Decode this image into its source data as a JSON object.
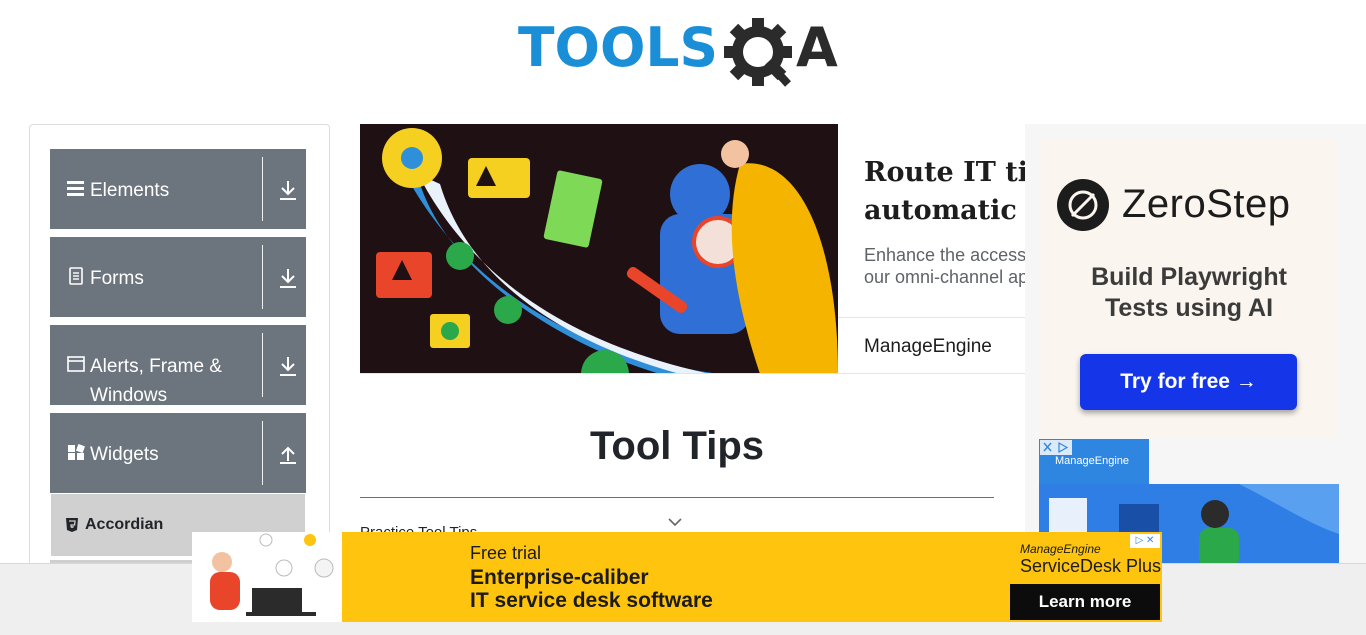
{
  "header": {
    "logo_text": "TOOLSQA"
  },
  "sidebar": {
    "groups": [
      {
        "label": "Elements",
        "icon": "hamburger-icon",
        "arrow": "download-arrow-icon"
      },
      {
        "label": "Forms",
        "icon": "document-icon",
        "arrow": "download-arrow-icon"
      },
      {
        "label": "Alerts, Frame & Windows",
        "icon": "window-icon",
        "arrow": "download-arrow-icon"
      },
      {
        "label": "Widgets",
        "icon": "widgets-icon",
        "arrow": "upload-arrow-icon"
      }
    ],
    "active_item": {
      "label": "Accordian",
      "icon": "html5-icon"
    }
  },
  "top_ad": {
    "headline": "Route IT ti\nautomatic",
    "description": "Enhance the access\nour omni-channel ap",
    "brand": "ManageEngine"
  },
  "main": {
    "title": "Tool Tips",
    "practice_label": "Practice Tool Tips"
  },
  "right_ad": {
    "brand": "ZeroStep",
    "tagline": "Build Playwright\nTests using AI",
    "cta": "Try for free →",
    "second_brand": "ManageEngine"
  },
  "bottom_ad": {
    "line1": "Free trial",
    "line2": "Enterprise-caliber",
    "line3": "IT service desk software",
    "brand_top": "ManageEngine",
    "brand_product": "ServiceDesk Plus",
    "cta": "Learn more"
  },
  "colors": {
    "sidebar_group_bg": "#6c757d",
    "active_item_bg": "#d0d0d0",
    "logo_blue": "#1a8fd8",
    "zerostep_button": "#1436e8",
    "bottom_ad_bg": "#ffc40d"
  }
}
